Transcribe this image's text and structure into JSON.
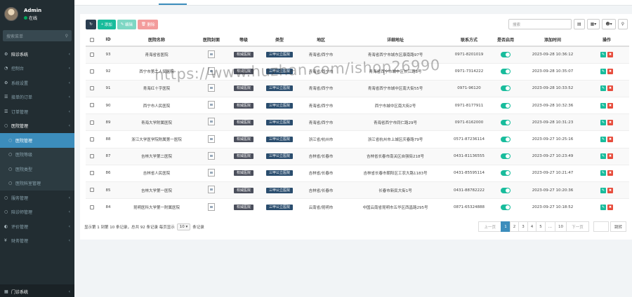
{
  "user": {
    "name": "Admin",
    "status": "在线"
  },
  "sidebar": {
    "search_placeholder": "搜索菜单",
    "items": [
      {
        "label": "陪诊系统",
        "icon": "gear-icon",
        "strong": true
      },
      {
        "label": "控制台",
        "icon": "dashboard-icon"
      },
      {
        "label": "系统设置",
        "icon": "settings-icon"
      },
      {
        "label": "接单的订单",
        "icon": "list-icon"
      },
      {
        "label": "订单管理",
        "icon": "list-icon"
      },
      {
        "label": "医院管理",
        "icon": "circle-icon",
        "strong": true
      },
      {
        "label": "医院管理",
        "icon": "circle-icon",
        "sub": true,
        "active": true
      },
      {
        "label": "医院等级",
        "icon": "circle-icon",
        "sub": true
      },
      {
        "label": "医院类型",
        "icon": "circle-icon",
        "sub": true
      },
      {
        "label": "医院科室管理",
        "icon": "circle-icon",
        "sub": true
      },
      {
        "label": "服务管理",
        "icon": "circle-icon"
      },
      {
        "label": "陪诊师管理",
        "icon": "circle-icon"
      },
      {
        "label": "评价管理",
        "icon": "comment-icon"
      },
      {
        "label": "财务管理",
        "icon": "yen-icon"
      }
    ],
    "bottom_item": "门诊系统"
  },
  "toolbar": {
    "add_label": "添加",
    "edit_label": "编辑",
    "delete_label": "删除",
    "search_placeholder": "搜索"
  },
  "table": {
    "headers": [
      "",
      "ID",
      "医院名称",
      "医院封面",
      "等级",
      "类型",
      "地区",
      "详细地址",
      "联系方式",
      "是否启用",
      "添加时间",
      "操作"
    ],
    "rows": [
      {
        "id": "93",
        "name": "青海省省医院",
        "grade": "权威医院",
        "type": "三甲公立医院",
        "region": "青海省/西宁市",
        "address": "青海省西宁市城东区康南路97号",
        "phone": "0971-8201019",
        "time": "2023-09-28 10:36:12"
      },
      {
        "id": "92",
        "name": "西宁市第二人民医院",
        "grade": "权威医院",
        "type": "三甲公立医院",
        "region": "青海省/西宁市",
        "address": "青海省西宁市城中区长江路8号",
        "phone": "0971-7314222",
        "time": "2023-09-28 10:35:07"
      },
      {
        "id": "91",
        "name": "青海红十字医院",
        "grade": "权威医院",
        "type": "三甲公立医院",
        "region": "青海省/西宁市",
        "address": "青海省西宁市城中区南大街55号",
        "phone": "0971-96120",
        "time": "2023-09-28 10:33:52"
      },
      {
        "id": "90",
        "name": "西宁市人民医院",
        "grade": "权威医院",
        "type": "三甲公立医院",
        "region": "青海省/西宁市",
        "address": "西宁市城中区南大街2号",
        "phone": "0971-8177911",
        "time": "2023-09-28 10:32:36"
      },
      {
        "id": "89",
        "name": "青海大学附属医院",
        "grade": "权威医院",
        "type": "三甲公立医院",
        "region": "青海省/西宁市",
        "address": "青海省西宁市同仁路29号",
        "phone": "0971-6162000",
        "time": "2023-09-28 10:31:23"
      },
      {
        "id": "88",
        "name": "浙江大学医学院附属第一医院",
        "grade": "权威医院",
        "type": "三甲公立医院",
        "region": "浙江省/杭州市",
        "address": "浙江省杭州市上城区庆春路79号",
        "phone": "0571-87236114",
        "time": "2023-09-27 10:25:16"
      },
      {
        "id": "87",
        "name": "吉林大学第二医院",
        "grade": "权威医院",
        "type": "三甲公立医院",
        "region": "吉林省/长春市",
        "address": "吉林省长春市南关区自强街218号",
        "phone": "0431-81136555",
        "time": "2023-09-27 10:23:49"
      },
      {
        "id": "86",
        "name": "吉林省人民医院",
        "grade": "权威医院",
        "type": "三甲公立医院",
        "region": "吉林省/长春市",
        "address": "吉林省长春市朝阳区工农大路1183号",
        "phone": "0431-85595114",
        "time": "2023-09-27 10:21:47"
      },
      {
        "id": "85",
        "name": "吉林大学第一医院",
        "grade": "权威医院",
        "type": "三甲公立医院",
        "region": "吉林省/长春市",
        "address": "长春市新民大街1号",
        "phone": "0431-88782222",
        "time": "2023-09-27 10:20:36"
      },
      {
        "id": "84",
        "name": "昆明医科大学第一附属医院",
        "grade": "权威医院",
        "type": "三甲公立医院",
        "region": "云南省/昆明市",
        "address": "中国云南省昆明市五华区西昌路295号",
        "phone": "0871-65324888",
        "time": "2023-09-27 10:18:52"
      }
    ]
  },
  "footer": {
    "summary_prefix": "显示第 1 到第 10 条记录，总共 92 条记录 每页显示",
    "page_size": "10",
    "summary_suffix": "条记录",
    "prev_label": "上一页",
    "next_label": "下一页",
    "pages": [
      "1",
      "2",
      "3",
      "4",
      "5",
      "...",
      "10"
    ],
    "current_page": "1",
    "jump_label": "跳转"
  },
  "watermark": "https://www.huzhan.com/ishop26990"
}
